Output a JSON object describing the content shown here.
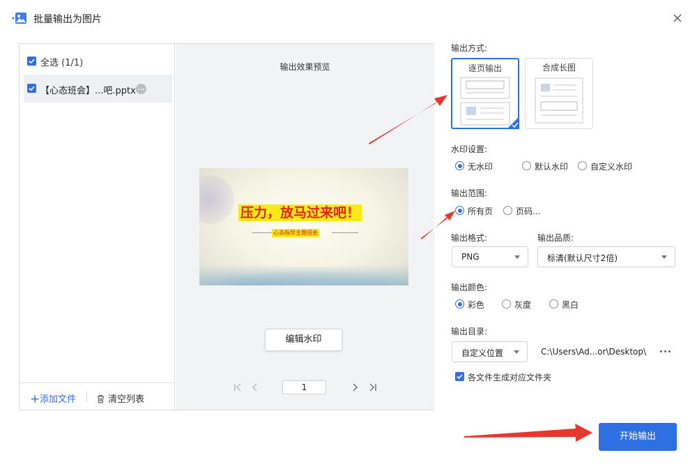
{
  "window": {
    "title": "批量输出为图片"
  },
  "file_list": {
    "select_all_label": "全选 (1/1)",
    "files": [
      {
        "name": "【心态班会】...吧.pptx",
        "checked": true
      }
    ],
    "add_file_label": "添加文件",
    "clear_list_label": "清空列表"
  },
  "preview": {
    "title": "输出效果预览",
    "slide_title": "压力，放马过来吧！",
    "slide_subtitle": "心态指导主题班会",
    "edit_watermark_label": "编辑水印",
    "current_page": "1"
  },
  "output_mode": {
    "label": "输出方式:",
    "options": [
      "逐页输出",
      "合成长图"
    ],
    "selected": "逐页输出"
  },
  "watermark": {
    "label": "水印设置:",
    "options": [
      "无水印",
      "默认水印",
      "自定义水印"
    ],
    "selected": "无水印"
  },
  "range": {
    "label": "输出范围:",
    "options": [
      "所有页",
      "页码..."
    ],
    "selected": "所有页"
  },
  "format": {
    "label": "输出格式:",
    "value": "PNG"
  },
  "quality": {
    "label": "输出品质:",
    "value": "标清(默认尺寸2倍)"
  },
  "color": {
    "label": "输出颜色:",
    "options": [
      "彩色",
      "灰度",
      "黑白"
    ],
    "selected": "彩色"
  },
  "directory": {
    "label": "输出目录:",
    "mode": "自定义位置",
    "path": "C:\\Users\\Ad...or\\Desktop\\",
    "subfolder_label": "各文件生成对应文件夹",
    "subfolder_checked": true
  },
  "start_button_label": "开始输出",
  "colors": {
    "accent": "#2f6fe4",
    "annotation_arrow": "#e8372c",
    "slide_highlight": "#f7ea16",
    "slide_title_text": "#e8211b"
  }
}
